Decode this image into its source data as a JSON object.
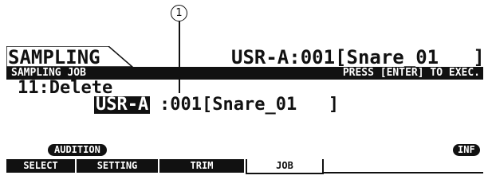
{
  "callout": {
    "number": "1"
  },
  "header": {
    "title": "SAMPLING",
    "voice_ref": "USR-A:001[Snare_01   ]"
  },
  "subheader": {
    "left": "SAMPLING JOB",
    "right": "PRESS [ENTER] TO EXEC."
  },
  "job": {
    "label": "11:Delete",
    "bank": "USR-A",
    "target": ":001[Snare_01   ]"
  },
  "buttons": {
    "audition": "AUDITION",
    "inf": "INF"
  },
  "tabs": [
    "SELECT",
    "SETTING",
    "TRIM",
    "JOB"
  ]
}
